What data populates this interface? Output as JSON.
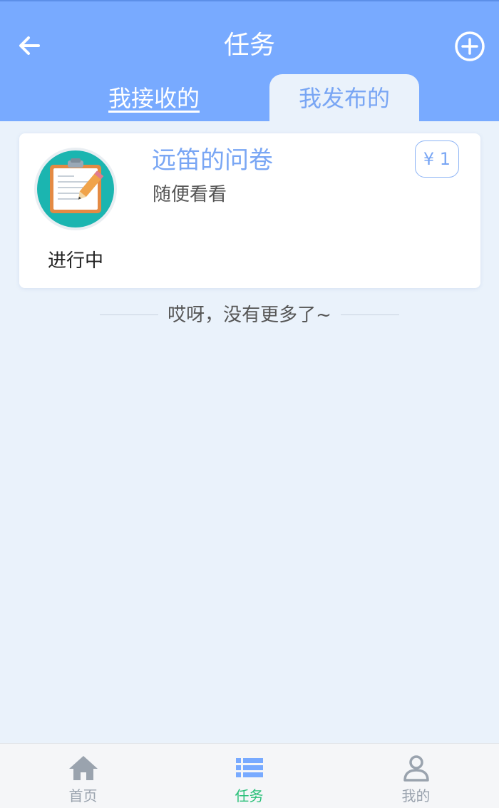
{
  "header": {
    "title": "任务",
    "back_icon": "arrow-left-icon",
    "add_icon": "plus-circle-icon",
    "background_color": "#78AAFF"
  },
  "tabs": [
    {
      "label": "我接收的",
      "active": false
    },
    {
      "label": "我发布的",
      "active": true
    }
  ],
  "tasks": [
    {
      "icon": "clipboard-pencil-icon",
      "status": "进行中",
      "title": "远笛的问卷",
      "description": "随便看看",
      "price": "¥ 1"
    }
  ],
  "list_end_text": "哎呀，没有更多了~",
  "bottom_nav": [
    {
      "label": "首页",
      "icon": "home-icon",
      "active": false
    },
    {
      "label": "任务",
      "icon": "list-icon",
      "active": true
    },
    {
      "label": "我的",
      "icon": "user-icon",
      "active": false
    }
  ],
  "colors": {
    "accent": "#78AAFF",
    "page_background": "#EAF2FB",
    "active_nav": "#2BC07A",
    "inactive_nav": "#9AA3AE"
  }
}
